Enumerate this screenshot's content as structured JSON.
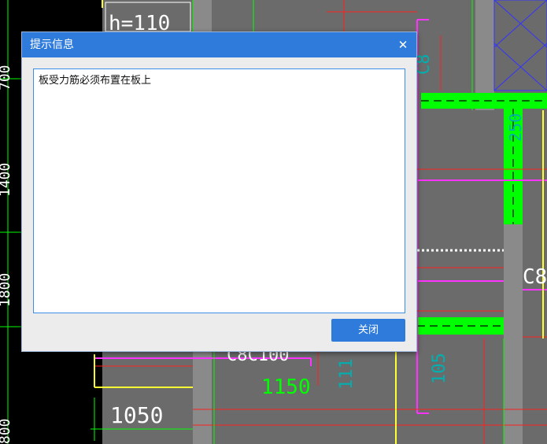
{
  "dialog": {
    "title": "提示信息",
    "close_glyph": "✕",
    "message": "板受力筋必须布置在板上",
    "button_label": "关闭"
  },
  "drawing": {
    "label_h110": "h=110",
    "label_1050": "1050",
    "label_1150": "1150",
    "label_c8c100": "C8C100",
    "label_c8": "C8",
    "label_c8_right": "C8",
    "label_250": "250",
    "label_111": "111",
    "label_105": "105",
    "label_left_top": "700",
    "label_left_mid": "1400",
    "label_left_low": "1800",
    "label_left_bottom": "800"
  },
  "colors": {
    "accent": "#2e7bdc",
    "cad_background": "#000000",
    "slab_fill": "#6b6b6b",
    "wall_gray": "#8a8a8a",
    "line_red": "#ff2020",
    "line_green": "#00ff00",
    "line_magenta": "#ff33ff",
    "line_yellow": "#ffff33",
    "line_blue": "#3333ff",
    "text_cyan": "#00b0b0"
  }
}
